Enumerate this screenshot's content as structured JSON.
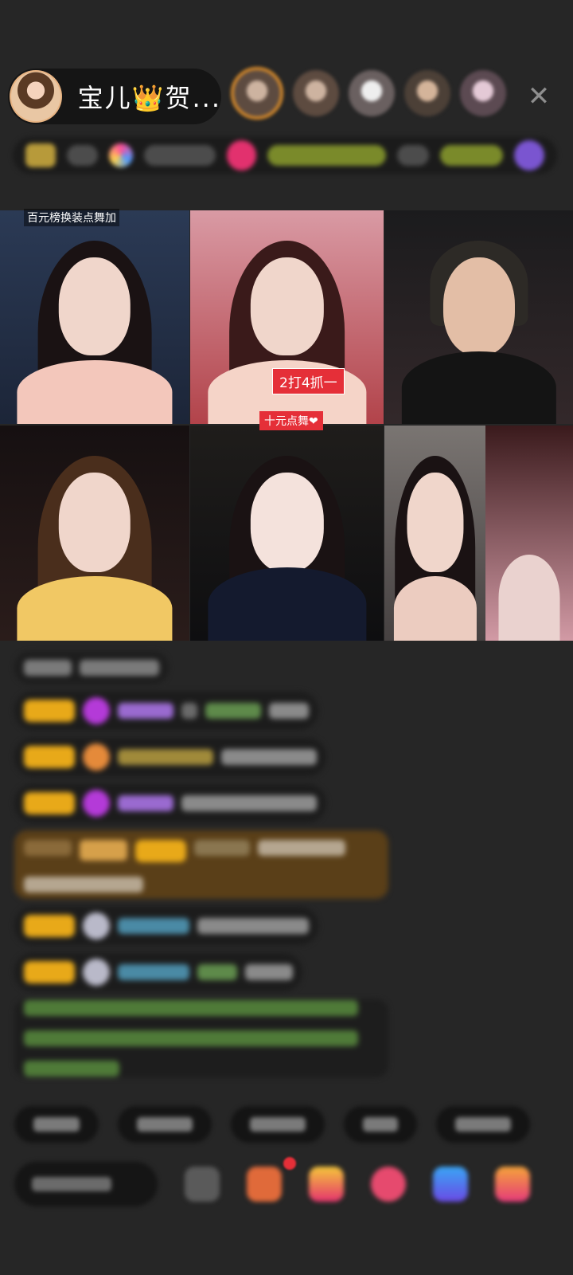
{
  "host": {
    "name": "宝儿👑贺..."
  },
  "header": {
    "close_icon": "close-icon",
    "viewer_count": 5
  },
  "video_grid": {
    "tags": {
      "top_left_banner": "百元榜换装点舞加",
      "promo_red": "2打4抓一",
      "promo_red_small": "十元点舞❤"
    }
  },
  "colors": {
    "background": "#262626",
    "badge_gold": "#e8a919",
    "accent_red": "#e52f38"
  }
}
